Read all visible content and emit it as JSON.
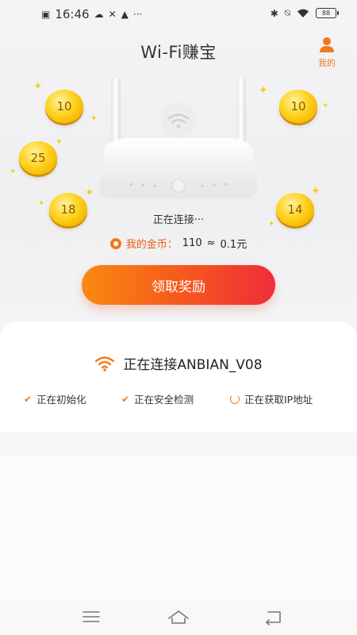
{
  "status_bar": {
    "time": "16:46",
    "battery": "88"
  },
  "header": {
    "title": "Wi-Fi赚宝",
    "mine_label": "我的"
  },
  "coins": [
    {
      "value": "10"
    },
    {
      "value": "25"
    },
    {
      "value": "18"
    },
    {
      "value": "10"
    },
    {
      "value": "14"
    }
  ],
  "router": {
    "status_text": "正在连接···"
  },
  "gold": {
    "label": "我的金币：",
    "amount": "110",
    "approx": "≈",
    "yuan": "0.1元"
  },
  "claim_button": "领取奖励",
  "connection_card": {
    "title": "正在连接ANBIAN_V08",
    "steps": [
      {
        "label": "正在初始化",
        "state": "done"
      },
      {
        "label": "正在安全检测",
        "state": "done"
      },
      {
        "label": "正在获取IP地址",
        "state": "loading"
      }
    ]
  },
  "colors": {
    "accent": "#f07a1b",
    "button_start": "#f98a12",
    "button_end": "#ef2d3a",
    "coin": "#ffd21f"
  },
  "icons": {
    "mine": "person-icon",
    "wifi": "wifi-icon",
    "nav": [
      "menu-icon",
      "home-icon",
      "back-icon"
    ]
  }
}
